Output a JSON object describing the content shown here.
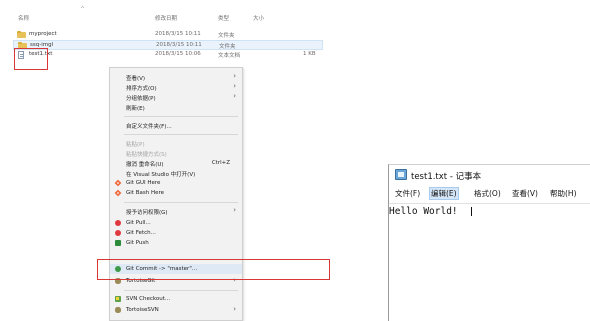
{
  "explorer": {
    "columns": {
      "name": "名称",
      "date": "修改日期",
      "type": "类型",
      "size": "大小"
    },
    "sort_arrow": "^",
    "files": [
      {
        "name": "myproject",
        "date": "2018/3/15 10:11",
        "type": "文件夹",
        "size": "",
        "icon": "folder-icon"
      },
      {
        "name": "ssq-imgl",
        "date": "2018/3/15 10:11",
        "type": "文件夹",
        "size": "",
        "icon": "folder-icon"
      },
      {
        "name": "test1.txt",
        "date": "2018/3/15 10:06",
        "type": "文本文档",
        "size": "1 KB",
        "icon": "text-file-icon"
      }
    ]
  },
  "context_menu": {
    "view": "查看(V)",
    "sort_by": "排序方式(O)",
    "group_by": "分组依据(P)",
    "refresh": "刷新(E)",
    "customize": "自定义文件夹(F)...",
    "paste": "粘贴(P)",
    "paste_shortcut": "粘贴快捷方式(S)",
    "undo_rename": "撤消 重命名(U)",
    "undo_shortcut": "Ctrl+Z",
    "open_vs": "在 Visual Studio 中打开(V)",
    "git_gui": "Git GUI Here",
    "git_bash": "Git Bash Here",
    "give_access": "授予访问权限(G)",
    "git_pull": "Git Pull...",
    "git_fetch": "Git Fetch...",
    "git_push": "Git Push",
    "git_commit": "Git Commit -> \"master\"...",
    "tortoisegit": "TortoiseGit",
    "svn_checkout": "SVN Checkout...",
    "tortoisesvn": "TortoiseSVN",
    "submenu_arrow": "›"
  },
  "notepad": {
    "title": "test1.txt - 记事本",
    "menus": [
      "文件(F)",
      "编辑(E)",
      "格式(O)",
      "查看(V)",
      "帮助(H)"
    ],
    "content": "Hello World!"
  },
  "colors": {
    "highlight": "#d93636",
    "menu_bg": "#f2f2f2",
    "folder": "#e7c25a"
  }
}
